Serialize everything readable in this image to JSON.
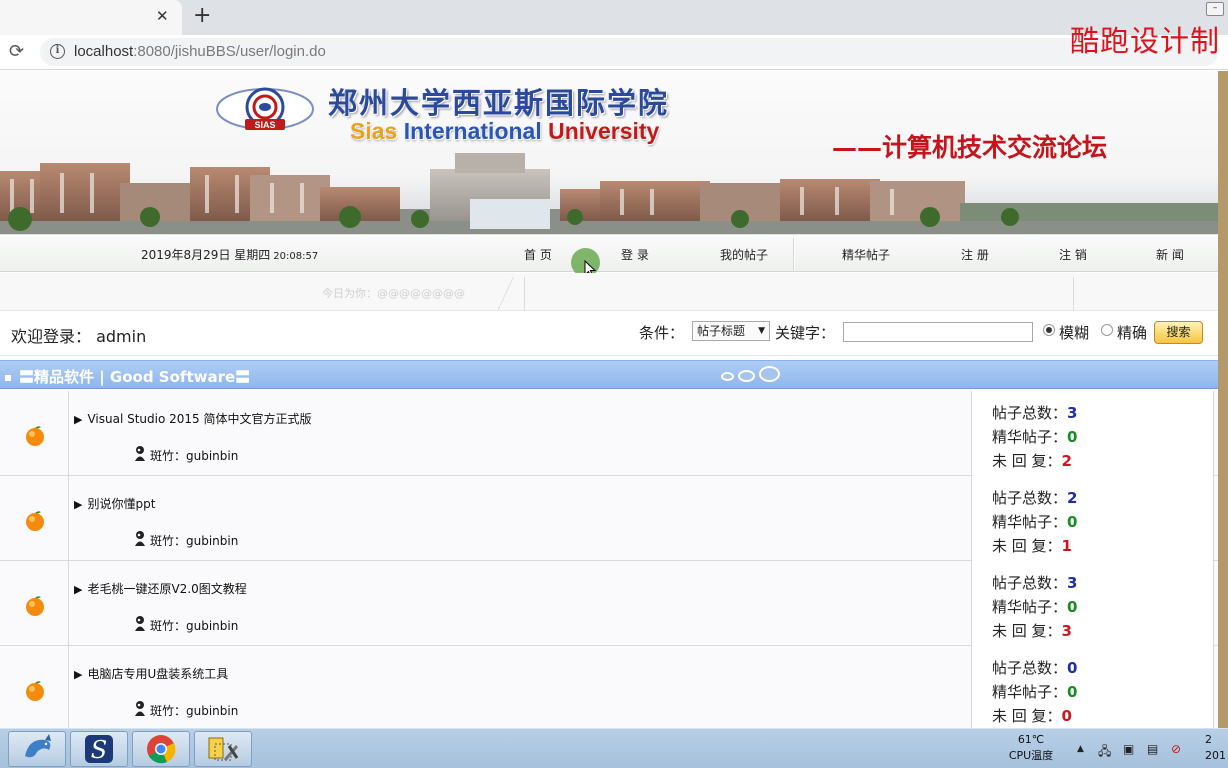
{
  "browser": {
    "url_host": "localhost",
    "url_rest": ":8080/jishuBBS/user/login.do",
    "watermark": "酷跑设计制"
  },
  "banner": {
    "cn_title": "郑州大学西亚斯国际学院",
    "en_title_1": "Sias",
    "en_title_2": "International",
    "en_title_3": "University",
    "slogan": "——计算机技术交流论坛",
    "logo_text": "SIAS"
  },
  "nav": {
    "date": "2019年8月29日 星期四",
    "time": "20:08:57",
    "items": [
      "首 页",
      "登 录",
      "我的帖子",
      "精华帖子",
      "注 册",
      "注 销",
      "新 闻"
    ]
  },
  "subbar": {
    "ghost_text": "今日为你：@@@@@@@@"
  },
  "search": {
    "welcome": "欢迎登录： admin",
    "condition_label": "条件：",
    "condition_value": "帖子标题",
    "keyword_label": "关键字：",
    "keyword_value": "",
    "mode_fuzzy": "模糊",
    "mode_exact": "精确",
    "selected_mode": "模糊",
    "button": "搜索"
  },
  "section": {
    "title": "〓精品软件 | Good Software〓"
  },
  "stat_labels": {
    "total": "帖子总数：",
    "elite": "精华帖子：",
    "unreplied": "未 回 复："
  },
  "boards": [
    {
      "title": "Visual Studio 2015 简体中文官方正式版",
      "moderator": "斑竹：gubinbin",
      "total": "3",
      "elite": "0",
      "unreplied": "2"
    },
    {
      "title": "别说你懂ppt",
      "moderator": "斑竹：gubinbin",
      "total": "2",
      "elite": "0",
      "unreplied": "1"
    },
    {
      "title": "老毛桃一键还原V2.0图文教程",
      "moderator": "斑竹：gubinbin",
      "total": "3",
      "elite": "0",
      "unreplied": "3"
    },
    {
      "title": "电脑店专用U盘装系统工具",
      "moderator": "斑竹：gubinbin",
      "total": "0",
      "elite": "0",
      "unreplied": "0"
    }
  ],
  "taskbar": {
    "cpu_temp": "61℃",
    "cpu_label": "CPU温度",
    "clock_1": "2",
    "clock_2": "201"
  },
  "colors": {
    "accent": "#8fb6ec",
    "total": "#1c2ea8",
    "elite": "#178a24",
    "unreplied": "#d0161c"
  }
}
